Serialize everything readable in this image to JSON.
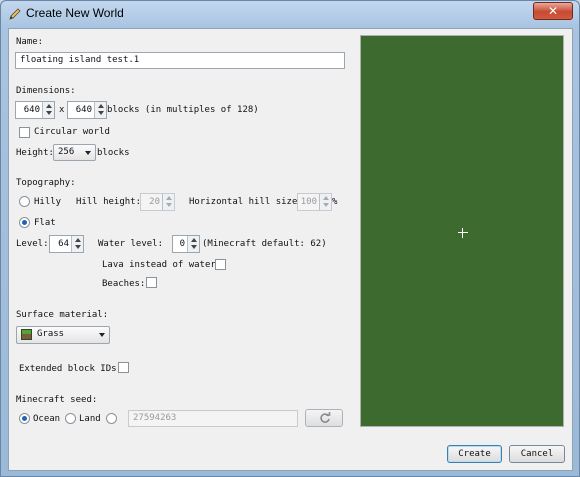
{
  "window": {
    "title": "Create New World",
    "close_glyph": "✕"
  },
  "name": {
    "label": "Name:",
    "value": "floating island test.1"
  },
  "dimensions": {
    "label": "Dimensions:",
    "width": "640",
    "times": "x",
    "height": "640",
    "suffix": "blocks (in multiples of 128)",
    "circular_label": "Circular world",
    "circular_checked": false
  },
  "height": {
    "label": "Height:",
    "value": "256",
    "suffix": "blocks"
  },
  "topography": {
    "label": "Topography:",
    "hilly_label": "Hilly",
    "hill_height_label": "Hill height:",
    "hill_height": "20",
    "horizontal_hill_label": "Horizontal hill size:",
    "horizontal_hill": "100",
    "percent": "%",
    "flat_label": "Flat",
    "selected": "Flat",
    "level_label": "Level:",
    "level": "64",
    "water_level_label": "Water level:",
    "water_level": "0",
    "water_hint": "(Minecraft default: 62)",
    "lava_label": "Lava instead of water:",
    "beaches_label": "Beaches:"
  },
  "surface": {
    "label": "Surface material:",
    "value": "Grass",
    "icon": "grass-block-icon"
  },
  "extended_ids": {
    "label": "Extended block IDs:"
  },
  "seed": {
    "label": "Minecraft seed:",
    "ocean_label": "Ocean",
    "land_label": "Land",
    "selected": "Ocean",
    "value": "27594263",
    "refresh_icon": "refresh-icon"
  },
  "buttons": {
    "create": "Create",
    "cancel": "Cancel"
  },
  "colors": {
    "preview": "#3d6a2f",
    "accent": "#2462b3"
  }
}
